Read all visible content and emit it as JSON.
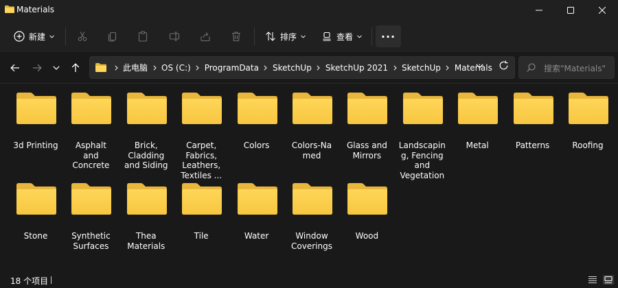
{
  "window": {
    "title": "Materials"
  },
  "toolbar": {
    "new_label": "新建",
    "sort_label": "排序",
    "view_label": "查看",
    "more_label": "···"
  },
  "address": {
    "crumbs": [
      "此电脑",
      "OS (C:)",
      "ProgramData",
      "SketchUp",
      "SketchUp 2021",
      "SketchUp",
      "Materials"
    ]
  },
  "search": {
    "placeholder": "搜索\"Materials\""
  },
  "items": [
    {
      "name": "3d Printing"
    },
    {
      "name": "Asphalt\nand\nConcrete"
    },
    {
      "name": "Brick,\nCladding\nand Siding"
    },
    {
      "name": "Carpet,\nFabrics,\nLeathers,\nTextiles ..."
    },
    {
      "name": "Colors"
    },
    {
      "name": "Colors-Na\nmed"
    },
    {
      "name": "Glass and\nMirrors"
    },
    {
      "name": "Landscapin\ng, Fencing\nand\nVegetation"
    },
    {
      "name": "Metal"
    },
    {
      "name": "Patterns"
    },
    {
      "name": "Roofing"
    },
    {
      "name": "Stone"
    },
    {
      "name": "Synthetic\nSurfaces"
    },
    {
      "name": "Thea\nMaterials"
    },
    {
      "name": "Tile"
    },
    {
      "name": "Water"
    },
    {
      "name": "Window\nCoverings"
    },
    {
      "name": "Wood"
    }
  ],
  "status": {
    "count_text": "18 个项目"
  },
  "colors": {
    "background": "#191919",
    "chrome": "#202020",
    "folder_back": "#e9b73c",
    "folder_front": "#ffd659"
  }
}
